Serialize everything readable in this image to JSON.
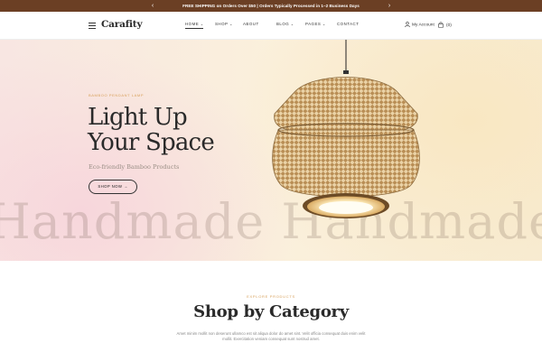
{
  "announcement": {
    "text": "FREE SHIPPING on Orders Over $50 | Orders Typically Processed in 1–2 Business Days",
    "prev": "‹",
    "next": "›"
  },
  "header": {
    "logo": "Carafity",
    "nav": [
      {
        "label": "HOME",
        "has_dropdown": true,
        "active": true
      },
      {
        "label": "SHOP",
        "has_dropdown": true,
        "active": false
      },
      {
        "label": "ABOUT",
        "has_dropdown": false,
        "active": false
      },
      {
        "label": "BLOG",
        "has_dropdown": true,
        "active": false
      },
      {
        "label": "PAGES",
        "has_dropdown": true,
        "active": false
      },
      {
        "label": "CONTACT",
        "has_dropdown": false,
        "active": false
      }
    ],
    "account_label": "My Account",
    "cart_count": "(0)",
    "chevron": "⌄"
  },
  "hero": {
    "tagline": "BAMBOO PENDANT LAMP",
    "headline_line1": "Light Up",
    "headline_line2": "Your Space",
    "subline": "Eco-friendly Bamboo Products",
    "button_label": "SHOP NOW →",
    "watermark": "de  Handmade  Handmade"
  },
  "category": {
    "eyebrow": "EXPLORE PRODUCTS",
    "title": "Shop by Category",
    "description": "Amet minim mollit non deserunt ullamco est sit aliqua dolor do amet sint. Velit officia consequat duis enim velit mollit. Exercitation veniam consequat sunt nostrud amet."
  },
  "colors": {
    "topbar": "#6b3f24",
    "accent": "#d8a15c",
    "text": "#2a2a2a"
  }
}
